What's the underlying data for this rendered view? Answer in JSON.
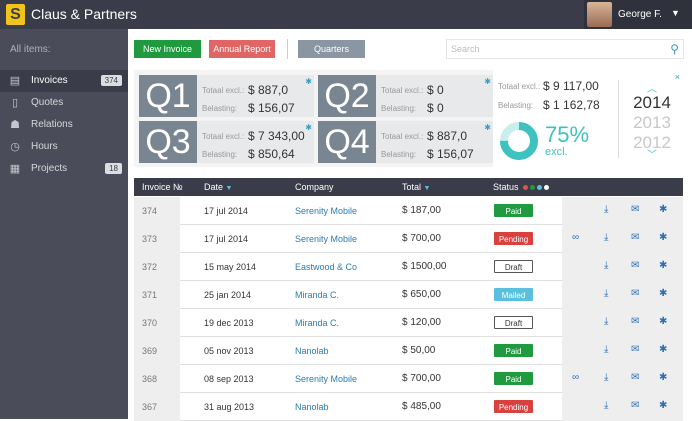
{
  "app": {
    "title": "Claus & Partners",
    "logo_letter": "S"
  },
  "user": {
    "name": "George F.",
    "caret": "▼"
  },
  "sidebar": {
    "header": "All items:",
    "items": [
      {
        "label": "Invoices",
        "icon": "document-icon",
        "count": "374",
        "active": true
      },
      {
        "label": "Quotes",
        "icon": "page-icon",
        "count": "",
        "active": false
      },
      {
        "label": "Relations",
        "icon": "people-icon",
        "count": "",
        "active": false
      },
      {
        "label": "Hours",
        "icon": "clock-icon",
        "count": "",
        "active": false
      },
      {
        "label": "Projects",
        "icon": "buildings-icon",
        "count": "18",
        "active": false
      }
    ]
  },
  "toolbar": {
    "new_invoice": "New Invoice",
    "annual_report": "Annual Report",
    "quarters": "Quarters",
    "search_placeholder": "Search",
    "colors": {
      "new": "#1f9a3e",
      "annual": "#e06565",
      "quarters": "#8b96a3"
    }
  },
  "quarters": [
    {
      "name": "Q1",
      "excl_label": "Totaal excl.:",
      "excl": "$ 887,0",
      "tax_label": "Belasting:",
      "tax": "$ 156,07"
    },
    {
      "name": "Q2",
      "excl_label": "Totaal excl.:",
      "excl": "$ 0",
      "tax_label": "Belasting:",
      "tax": "$ 0"
    },
    {
      "name": "Q3",
      "excl_label": "Totaal excl.:",
      "excl": "$ 7 343,00",
      "tax_label": "Belasting:",
      "tax": "$ 850,64"
    },
    {
      "name": "Q4",
      "excl_label": "Totaal excl.:",
      "excl": "$ 887,0",
      "tax_label": "Belasting:",
      "tax": "$ 156,07"
    }
  ],
  "totals": {
    "excl_label": "Totaal excl.:",
    "excl": "$ 9 117,00",
    "tax_label": "Belasting:",
    "tax": "$ 1 162,78",
    "percent": "75%",
    "percent_value": 75,
    "percent_label": "excl.",
    "close": "×"
  },
  "years": {
    "up": "︿",
    "list": [
      "2014",
      "2013",
      "2012"
    ],
    "down": "﹀"
  },
  "table": {
    "headers": {
      "invoice": "Invoice №",
      "date": "Date",
      "company": "Company",
      "total": "Total",
      "status": "Status"
    },
    "status_dot_colors": [
      "#d9534f",
      "#1f9a3e",
      "#5bc0de",
      "#ffffff"
    ],
    "rows": [
      {
        "no": "374",
        "date": "17 jul 2014",
        "company": "Serenity Mobile",
        "total": "$ 187,00",
        "status": "Paid",
        "link": false
      },
      {
        "no": "373",
        "date": "17 jul 2014",
        "company": "Serenity Mobile",
        "total": "$ 700,00",
        "status": "Pending",
        "link": true
      },
      {
        "no": "372",
        "date": "15 may 2014",
        "company": "Eastwood & Co",
        "total": "$ 1500,00",
        "status": "Draft",
        "link": false
      },
      {
        "no": "371",
        "date": "25 jan 2014",
        "company": "Miranda C.",
        "total": "$ 650,00",
        "status": "Mailed",
        "link": false
      },
      {
        "no": "370",
        "date": "19 dec 2013",
        "company": "Miranda C.",
        "total": "$ 120,00",
        "status": "Draft",
        "link": false
      },
      {
        "no": "369",
        "date": "05 nov 2013",
        "company": "Nanolab",
        "total": "$ 50,00",
        "status": "Paid",
        "link": false
      },
      {
        "no": "368",
        "date": "08 sep 2013",
        "company": "Serenity Mobile",
        "total": "$ 700,00",
        "status": "Paid",
        "link": true
      },
      {
        "no": "367",
        "date": "31 aug 2013",
        "company": "Nanolab",
        "total": "$ 485,00",
        "status": "Pending",
        "link": false
      }
    ],
    "status_styles": {
      "Paid": {
        "bg": "#1f9a3e",
        "fg": "#ffffff",
        "border": "#1f9a3e"
      },
      "Pending": {
        "bg": "#d9413f",
        "fg": "#ffffff",
        "border": "#d9413f"
      },
      "Draft": {
        "bg": "#ffffff",
        "fg": "#333333",
        "border": "#555555"
      },
      "Mailed": {
        "bg": "#5bc0de",
        "fg": "#ffffff",
        "border": "#5bc0de"
      }
    }
  }
}
